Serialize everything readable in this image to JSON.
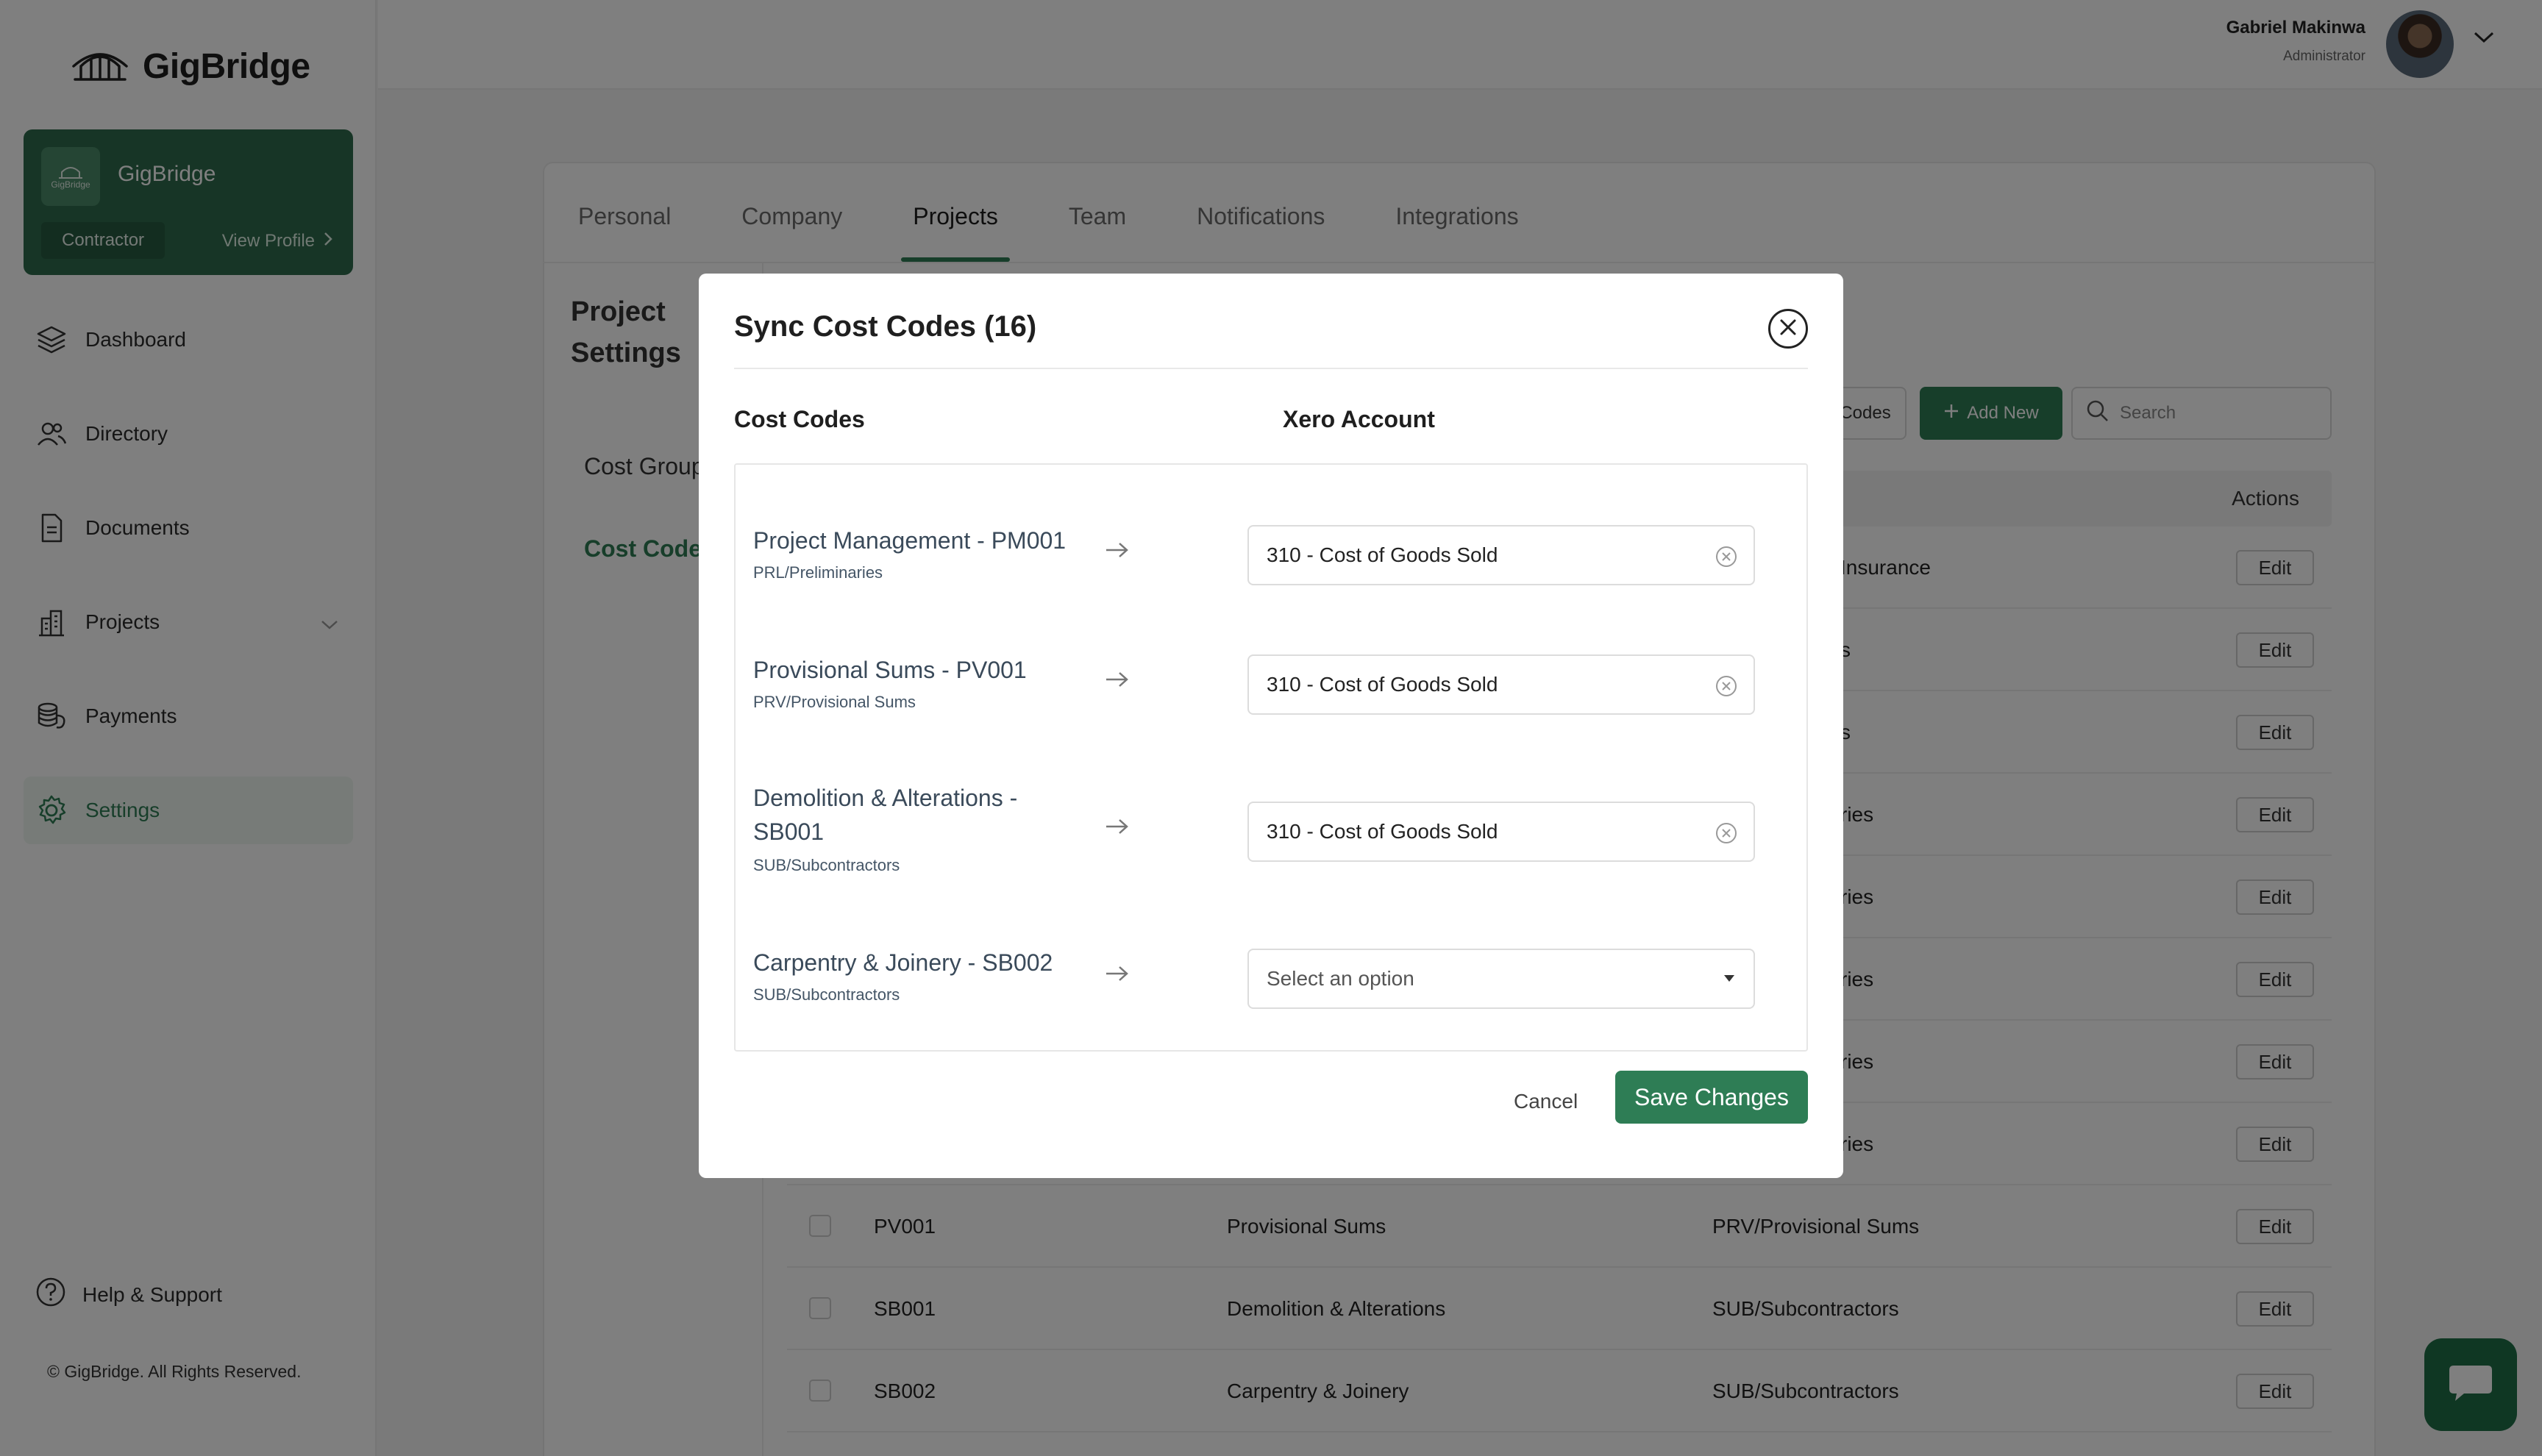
{
  "app": {
    "brand": "GigBridge",
    "profile_card": {
      "org_name": "GigBridge",
      "logo_text": "GigBridge",
      "role": "Contractor",
      "view_profile": "View Profile"
    },
    "nav": [
      {
        "label": "Dashboard",
        "icon": "layers-icon"
      },
      {
        "label": "Directory",
        "icon": "users-icon"
      },
      {
        "label": "Documents",
        "icon": "document-icon"
      },
      {
        "label": "Projects",
        "icon": "building-icon"
      },
      {
        "label": "Payments",
        "icon": "coins-icon"
      },
      {
        "label": "Settings",
        "icon": "gear-icon",
        "active": true
      }
    ],
    "help": "Help & Support",
    "copyright": "© GigBridge. All Rights Reserved."
  },
  "user": {
    "name": "Gabriel Makinwa",
    "role": "Administrator"
  },
  "tabs": [
    "Personal",
    "Company",
    "Projects",
    "Team",
    "Notifications",
    "Integrations"
  ],
  "active_tab": "Projects",
  "settings": {
    "title_line1": "Project",
    "title_line2": "Settings",
    "links": [
      "Cost Group",
      "Cost Codes"
    ]
  },
  "toolbar": {
    "codes_button": "Codes",
    "add_new": "Add New",
    "search_placeholder": "Search"
  },
  "table": {
    "actions_header": "Actions",
    "partial_rows": [
      "Insurance",
      "s",
      "s",
      "ries",
      "ries",
      "ries",
      "ries",
      "ries"
    ],
    "rows": [
      {
        "code": "PV001",
        "name": "Provisional Sums",
        "group": "PRV/Provisional Sums"
      },
      {
        "code": "SB001",
        "name": "Demolition & Alterations",
        "group": "SUB/Subcontractors"
      },
      {
        "code": "SB002",
        "name": "Carpentry & Joinery",
        "group": "SUB/Subcontractors"
      }
    ],
    "edit_label": "Edit"
  },
  "modal": {
    "title": "Sync Cost Codes (16)",
    "col_cost_codes": "Cost Codes",
    "col_xero_account": "Xero Account",
    "mappings": [
      {
        "name": "Project Management - PM001",
        "group": "PRL/Preliminaries",
        "account": "310 - Cost of Goods Sold"
      },
      {
        "name": "Provisional Sums - PV001",
        "group": "PRV/Provisional Sums",
        "account": "310 - Cost of Goods Sold"
      },
      {
        "name": "Demolition & Alterations - SB001",
        "group": "SUB/Subcontractors",
        "account": "310 - Cost of Goods Sold"
      },
      {
        "name": "Carpentry & Joinery - SB002",
        "group": "SUB/Subcontractors",
        "account": "",
        "placeholder": "Select an option"
      }
    ],
    "cancel": "Cancel",
    "save": "Save Changes"
  },
  "colors": {
    "accent": "#2e7d55",
    "overlay": "rgba(0,0,0,0.5)"
  }
}
